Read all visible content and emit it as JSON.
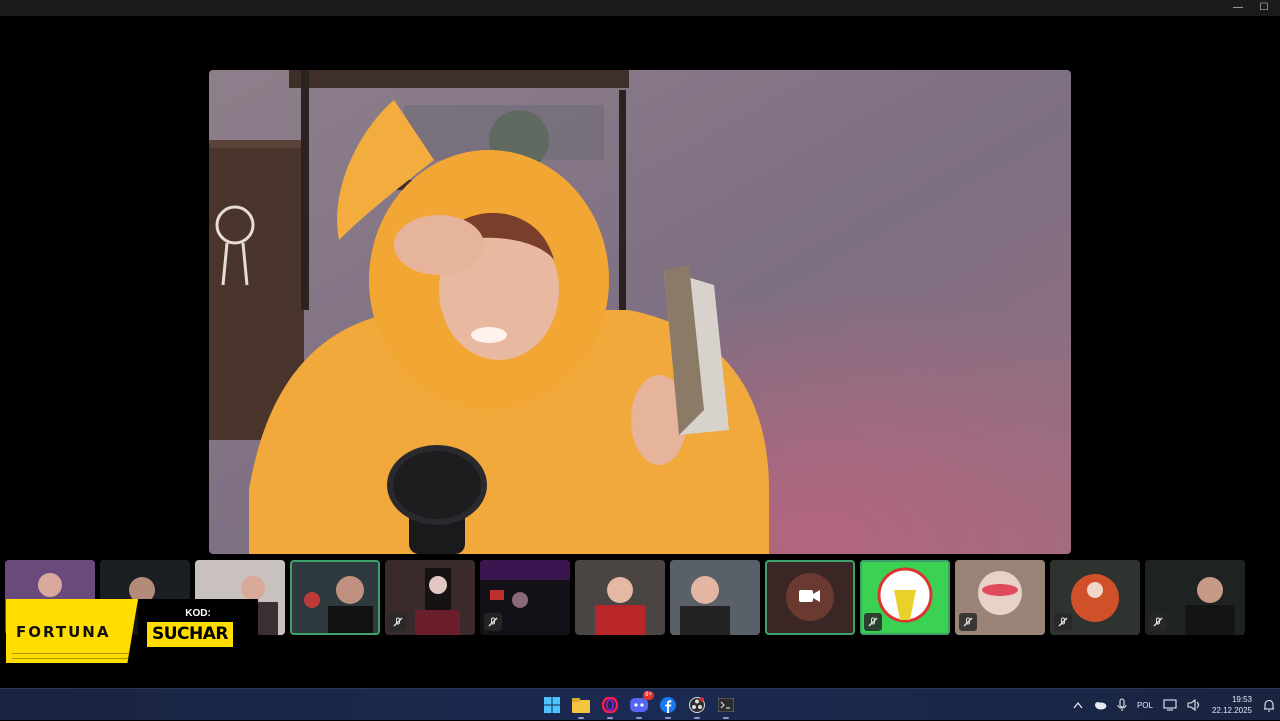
{
  "window": {
    "controls": {
      "minimize": "—",
      "maximize": "☐"
    }
  },
  "sponsor": {
    "brand": "FORTUNA",
    "code_label": "KOD:",
    "code_value": "SUCHAR"
  },
  "participants": [
    {
      "id": "p1",
      "speaking": false,
      "muted": false
    },
    {
      "id": "p2",
      "speaking": false,
      "muted": false
    },
    {
      "id": "p3",
      "speaking": false,
      "muted": false
    },
    {
      "id": "p4",
      "speaking": true,
      "muted": false
    },
    {
      "id": "p5",
      "speaking": false,
      "muted": true
    },
    {
      "id": "p6",
      "speaking": false,
      "muted": true
    },
    {
      "id": "p7",
      "speaking": false,
      "muted": false
    },
    {
      "id": "p8",
      "speaking": false,
      "muted": false
    },
    {
      "id": "p9",
      "speaking": true,
      "muted": false,
      "icon": "video-camera-icon"
    },
    {
      "id": "p10",
      "speaking": true,
      "muted": true
    },
    {
      "id": "p11",
      "speaking": false,
      "muted": true
    },
    {
      "id": "p12",
      "speaking": false,
      "muted": true
    },
    {
      "id": "p13",
      "speaking": false,
      "muted": true
    }
  ],
  "taskbar": {
    "apps": [
      {
        "name": "start-button",
        "icon": "windows-logo-icon"
      },
      {
        "name": "file-explorer-app",
        "icon": "folder-icon"
      },
      {
        "name": "opera-app",
        "icon": "opera-icon"
      },
      {
        "name": "discord-app",
        "icon": "discord-icon",
        "badge": "9+"
      },
      {
        "name": "facebook-app",
        "icon": "facebook-icon"
      },
      {
        "name": "obs-app",
        "icon": "obs-icon"
      },
      {
        "name": "terminal-app",
        "icon": "terminal-icon"
      }
    ],
    "tray": {
      "chevron": "^",
      "language": "POL"
    },
    "clock": {
      "time": "19:53",
      "date": "22.12.2025"
    }
  },
  "colors": {
    "accent_speaking": "#3ea06b",
    "sponsor_yellow": "#ffdd00",
    "taskbar": "#1b2a52"
  }
}
